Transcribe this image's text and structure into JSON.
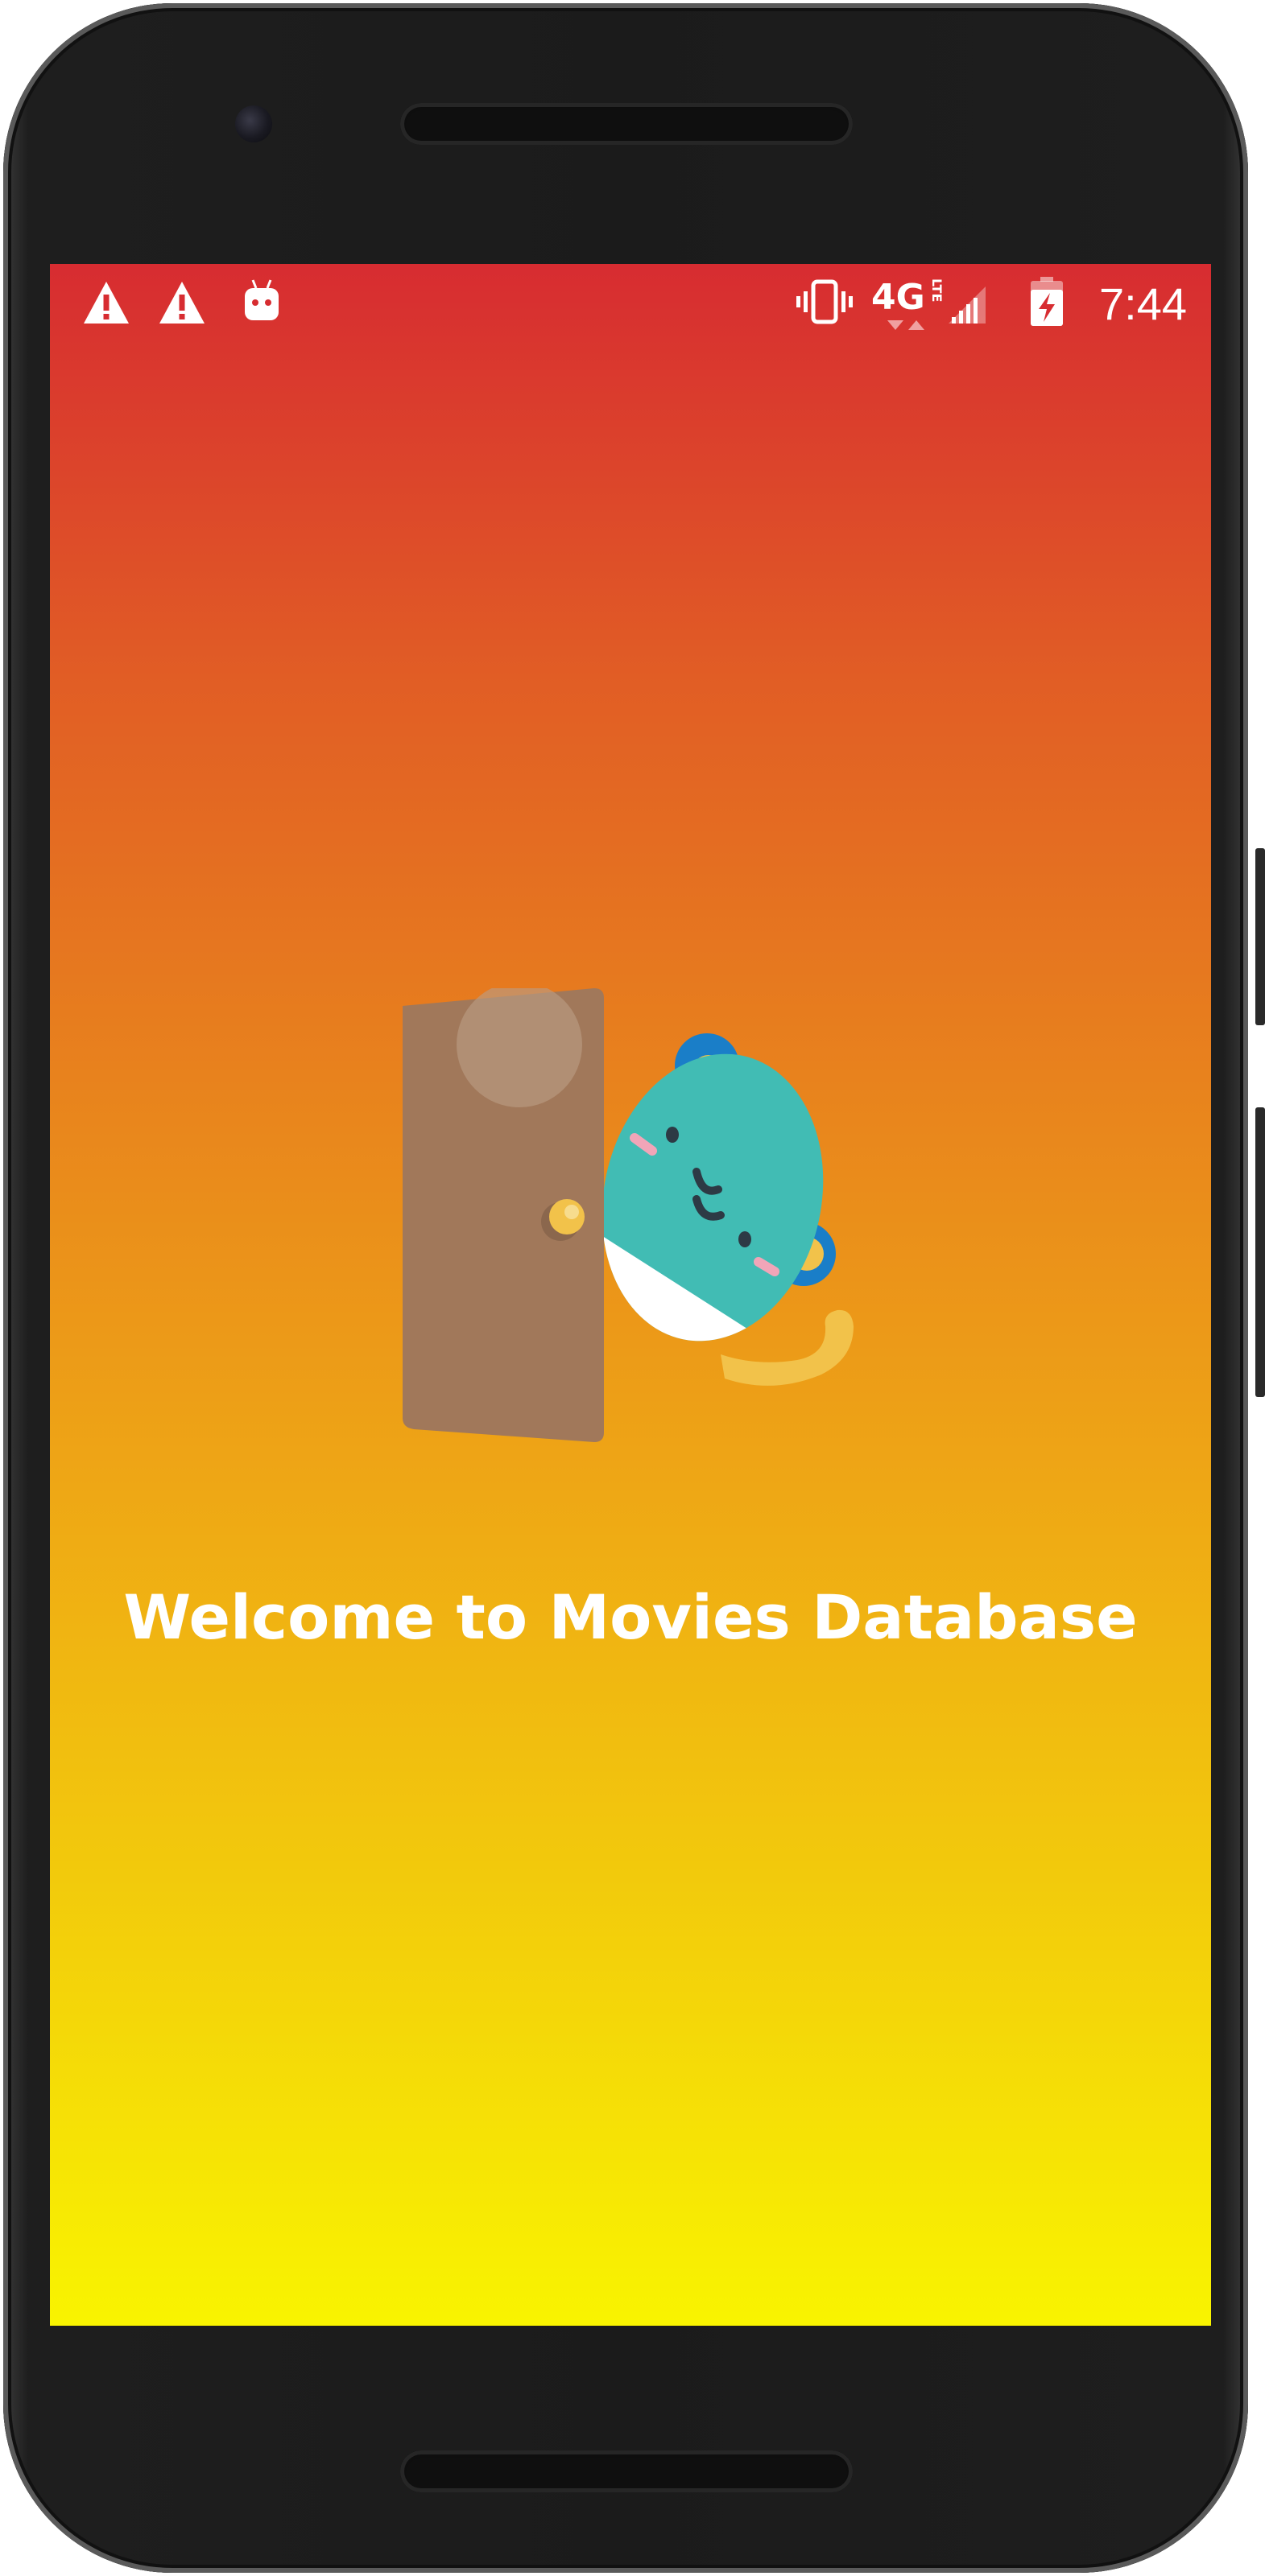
{
  "status_bar": {
    "time": "7:44",
    "network": "4G",
    "network_sub": "LTE",
    "left_icons": [
      "warning-icon",
      "warning-icon",
      "android-debug-icon"
    ],
    "right_icons": [
      "vibrate-icon",
      "network-4g-lte-icon",
      "signal-icon",
      "battery-charging-icon"
    ]
  },
  "main": {
    "illustration": "monkey-peeking-door-illustration",
    "welcome_text": "Welcome to Movies Database"
  },
  "colors": {
    "gradient_top": "#d72c31",
    "gradient_bottom": "#f9f400",
    "text": "#ffffff"
  }
}
